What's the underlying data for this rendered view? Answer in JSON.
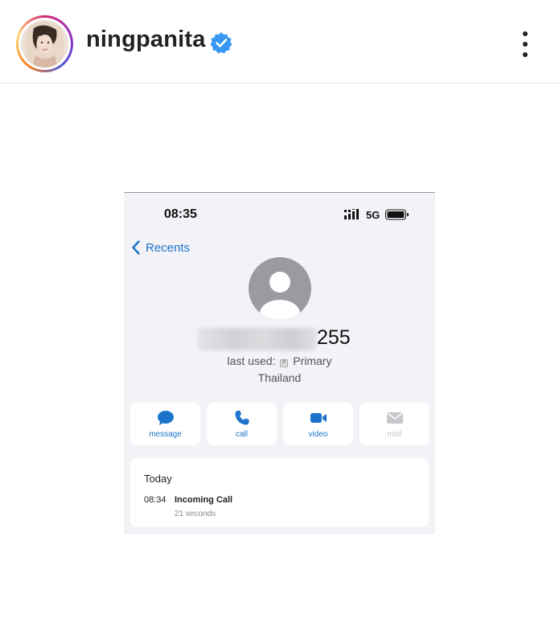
{
  "post_header": {
    "username": "ningpanita",
    "verified": true,
    "more_icon": "more-vertical-icon"
  },
  "phone": {
    "status_bar": {
      "time": "08:35",
      "network": "5G",
      "signal_icon": "signal-bars-icon",
      "battery_icon": "battery-icon"
    },
    "nav": {
      "back_label": "Recents"
    },
    "contact": {
      "number_visible_suffix": "255",
      "number_prefix_blurred": true,
      "last_used_prefix": "last used:",
      "sim_badge": "P",
      "last_used_line": "Primary",
      "country": "Thailand"
    },
    "actions": [
      {
        "label": "message",
        "icon": "message-bubble-icon",
        "enabled": true
      },
      {
        "label": "call",
        "icon": "phone-icon",
        "enabled": true
      },
      {
        "label": "video",
        "icon": "video-camera-icon",
        "enabled": true
      },
      {
        "label": "mail",
        "icon": "mail-icon",
        "enabled": false
      }
    ],
    "call_history": {
      "title": "Today",
      "entries": [
        {
          "time": "08:34",
          "type": "Incoming Call",
          "duration": "21 seconds"
        }
      ]
    },
    "colors": {
      "accent": "#1b74c9",
      "background": "#f2f2f7"
    }
  }
}
